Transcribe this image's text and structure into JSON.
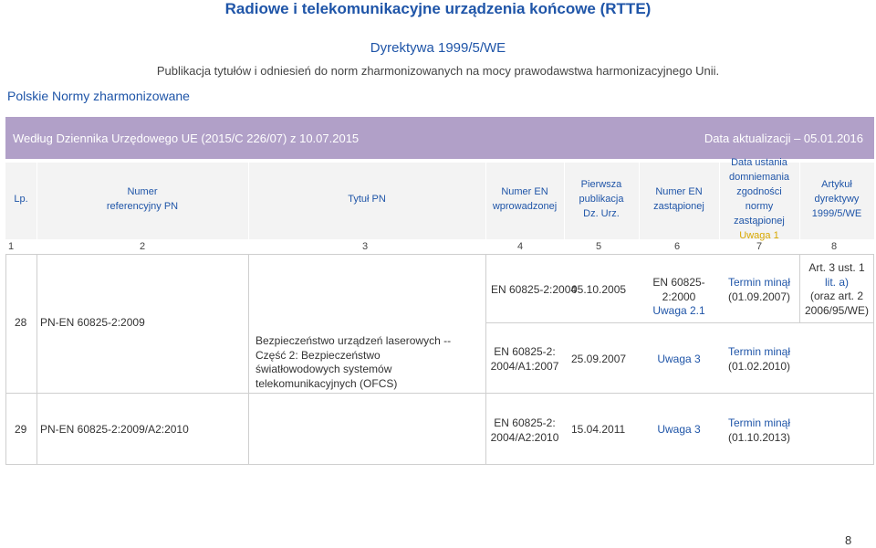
{
  "header": {
    "title": "Radiowe i telekomunikacyjne urządzenia końcowe (RTTE)",
    "directive": "Dyrektywa 1999/5/WE",
    "publication_note": "Publikacja tytułów i odniesień do norm zharmonizowanych na mocy prawodawstwa harmonizacyjnego Unii.",
    "pn_label": "Polskie Normy zharmonizowane"
  },
  "banner": {
    "left": "Według Dziennika Urzędowego UE (2015/C 226/07) z 10.07.2015",
    "right": "Data aktualizacji – 05.01.2016"
  },
  "columns": {
    "lp": "Lp.",
    "ref_pn_1": "Numer",
    "ref_pn_2": "referencyjny PN",
    "title_pn": "Tytuł PN",
    "en_intro_1": "Numer EN",
    "en_intro_2": "wprowadzonej",
    "first_pub_1": "Pierwsza",
    "first_pub_2": "publikacja",
    "first_pub_3": "Dz. Urz.",
    "en_replaced_1": "Numer EN",
    "en_replaced_2": "zastąpionej",
    "presumption_1": "Data ustania",
    "presumption_2": "domniemania",
    "presumption_3": "zgodności",
    "presumption_4": "normy",
    "presumption_5": "zastąpionej",
    "presumption_6": "Uwaga 1",
    "article_1": "Artykuł",
    "article_2": "dyrektywy",
    "article_3": "1999/5/WE"
  },
  "column_numbers": [
    "1",
    "2",
    "3",
    "4",
    "5",
    "6",
    "7",
    "8"
  ],
  "rows": {
    "r28": {
      "lp": "28",
      "ref": "PN-EN 60825-2:2009",
      "title_1": "Bezpieczeństwo urządzeń laserowych --",
      "title_2": "Część 2: Bezpieczeństwo",
      "title_3": "światłowodowych systemów",
      "title_4": "telekomunikacyjnych (OFCS)",
      "a_en": "EN 60825-2:2004",
      "a_date": "05.10.2005",
      "a_replaced_1": "EN 60825-2:2000",
      "a_replaced_2": "Uwaga 2.1",
      "a_term_1": "Termin minął",
      "a_term_2": "(01.09.2007)",
      "art_1": "Art. 3 ust. 1",
      "art_2": "lit. a)",
      "art_3": "(oraz art. 2",
      "art_4": "2006/95/WE)",
      "b_en_1": "EN 60825-2:",
      "b_en_2": "2004/A1:2007",
      "b_date": "25.09.2007",
      "b_note": "Uwaga 3",
      "b_term_1": "Termin minął",
      "b_term_2": "(01.02.2010)"
    },
    "r29": {
      "lp": "29",
      "ref": "PN-EN 60825-2:2009/A2:2010",
      "en_1": "EN 60825-2:",
      "en_2": "2004/A2:2010",
      "date": "15.04.2011",
      "note": "Uwaga 3",
      "term_1": "Termin minął",
      "term_2": "(01.10.2013)"
    }
  },
  "page_number": "8"
}
